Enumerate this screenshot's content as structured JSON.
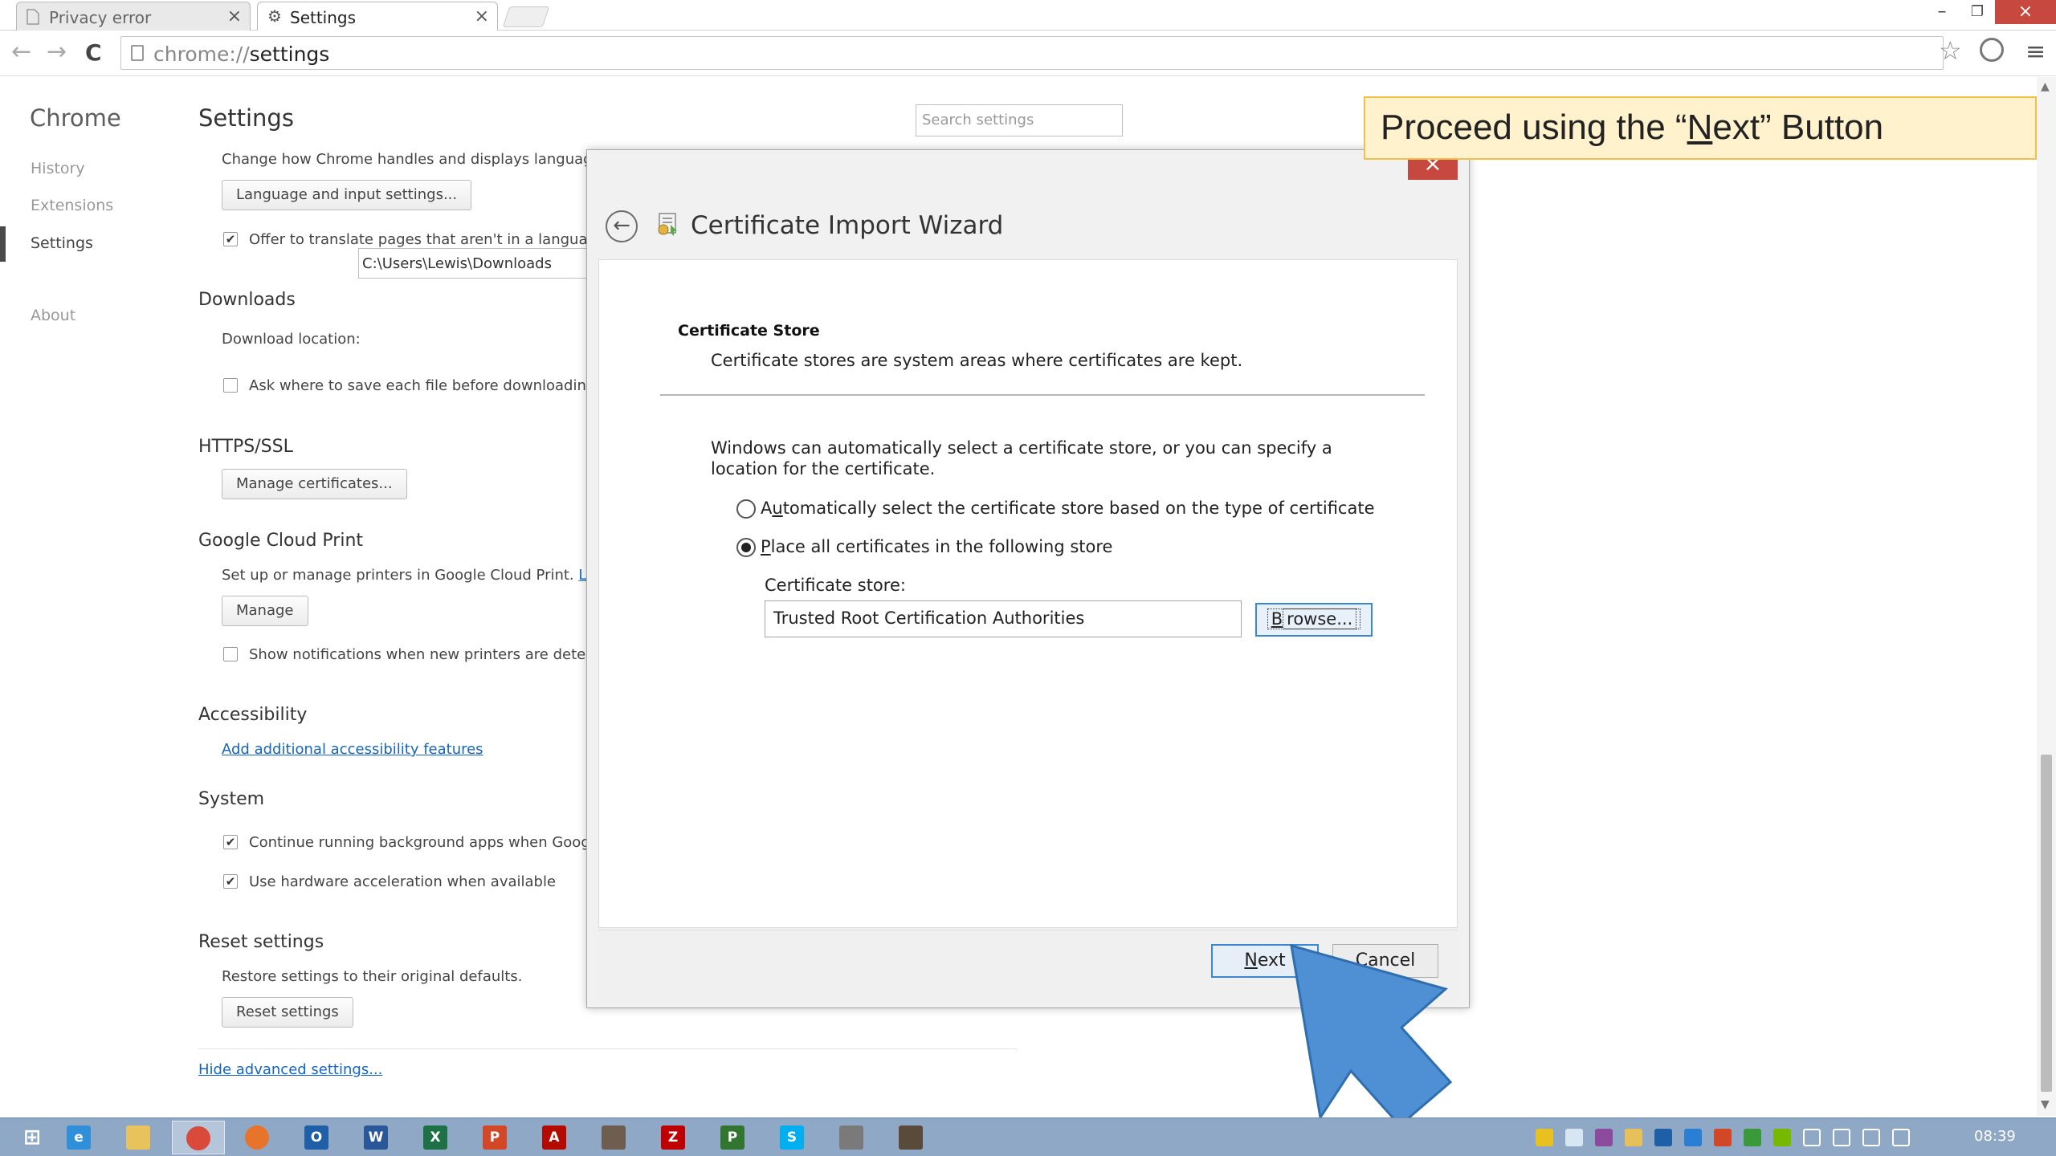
{
  "browser": {
    "tabs": [
      {
        "title": "Privacy error",
        "close": "×"
      },
      {
        "title": "Settings",
        "close": "×"
      }
    ],
    "window_controls": {
      "minimize": "–",
      "restore": "❐",
      "close": "×"
    },
    "nav": {
      "back": "←",
      "forward": "→",
      "reload": "C"
    },
    "url_scheme": "chrome://",
    "url_path": "settings",
    "star": "☆",
    "menu": "≡"
  },
  "settings": {
    "sidebar": {
      "title": "Chrome",
      "items": [
        "History",
        "Extensions",
        "Settings",
        "About"
      ]
    },
    "title": "Settings",
    "search_placeholder": "Search settings",
    "languages": {
      "desc": "Change how Chrome handles and displays languages.",
      "button": "Language and input settings...",
      "translate_label": "Offer to translate pages that aren't in a language"
    },
    "downloads": {
      "heading": "Downloads",
      "location_label": "Download location:",
      "location_value": "C:\\Users\\Lewis\\Downloads",
      "ask_label": "Ask where to save each file before downloading"
    },
    "https": {
      "heading": "HTTPS/SSL",
      "button": "Manage certificates..."
    },
    "cloud_print": {
      "heading": "Google Cloud Print",
      "desc": "Set up or manage printers in Google Cloud Print.",
      "learn_link": "Lear",
      "button": "Manage",
      "notify_label": "Show notifications when new printers are detecte"
    },
    "accessibility": {
      "heading": "Accessibility",
      "link": "Add additional accessibility features"
    },
    "system": {
      "heading": "System",
      "background_label": "Continue running background apps when Google",
      "hardware_label": "Use hardware acceleration when available"
    },
    "reset": {
      "heading": "Reset settings",
      "desc": "Restore settings to their original defaults.",
      "button": "Reset settings"
    },
    "hide_link": "Hide advanced settings..."
  },
  "dialog": {
    "close": "×",
    "back": "←",
    "title": "Certificate Import Wizard",
    "heading": "Certificate Store",
    "description": "Certificate stores are system areas where certificates are kept.",
    "auto_text": "Windows can automatically select a certificate store, or you can specify a location for the certificate.",
    "radio_auto_pre": "A",
    "radio_auto_ul": "u",
    "radio_auto_post": "tomatically select the certificate store based on the type of certificate",
    "radio_auto_selected": false,
    "radio_place_ul": "P",
    "radio_place_post": "lace all certificates in the following store",
    "radio_place_selected": true,
    "store_label": "Certificate store:",
    "store_value": "Trusted Root Certification Authorities",
    "browse_ul": "B",
    "browse_post": "rowse...",
    "next_ul": "N",
    "next_post": "ext",
    "cancel": "Cancel"
  },
  "callout": {
    "pre": "Proceed using the “",
    "ul": "N",
    "post": "ext” Button"
  },
  "taskbar": {
    "apps": [
      {
        "name": "start",
        "glyph": "",
        "color": "#ffffff"
      },
      {
        "name": "ie",
        "glyph": "e",
        "color": "#2f8fd9"
      },
      {
        "name": "explorer",
        "glyph": "",
        "color": "#e8c25a"
      },
      {
        "name": "chrome",
        "glyph": "",
        "color": "#d94a3a"
      },
      {
        "name": "firefox",
        "glyph": "",
        "color": "#e8742b"
      },
      {
        "name": "outlook",
        "glyph": "O",
        "color": "#1f5fa8"
      },
      {
        "name": "word",
        "glyph": "W",
        "color": "#2a579a"
      },
      {
        "name": "excel",
        "glyph": "X",
        "color": "#1e7145"
      },
      {
        "name": "powerpoint",
        "glyph": "P",
        "color": "#d24726"
      },
      {
        "name": "acrobat",
        "glyph": "A",
        "color": "#b30b00"
      },
      {
        "name": "gimp",
        "glyph": "",
        "color": "#6d5e4f"
      },
      {
        "name": "filezilla",
        "glyph": "Z",
        "color": "#bf0000"
      },
      {
        "name": "project",
        "glyph": "P",
        "color": "#31752f"
      },
      {
        "name": "skype",
        "glyph": "S",
        "color": "#00aff0"
      },
      {
        "name": "network",
        "glyph": "",
        "color": "#7a7a7a"
      },
      {
        "name": "terminal",
        "glyph": "",
        "color": "#5a4a3a"
      }
    ],
    "clock": "08:39"
  }
}
